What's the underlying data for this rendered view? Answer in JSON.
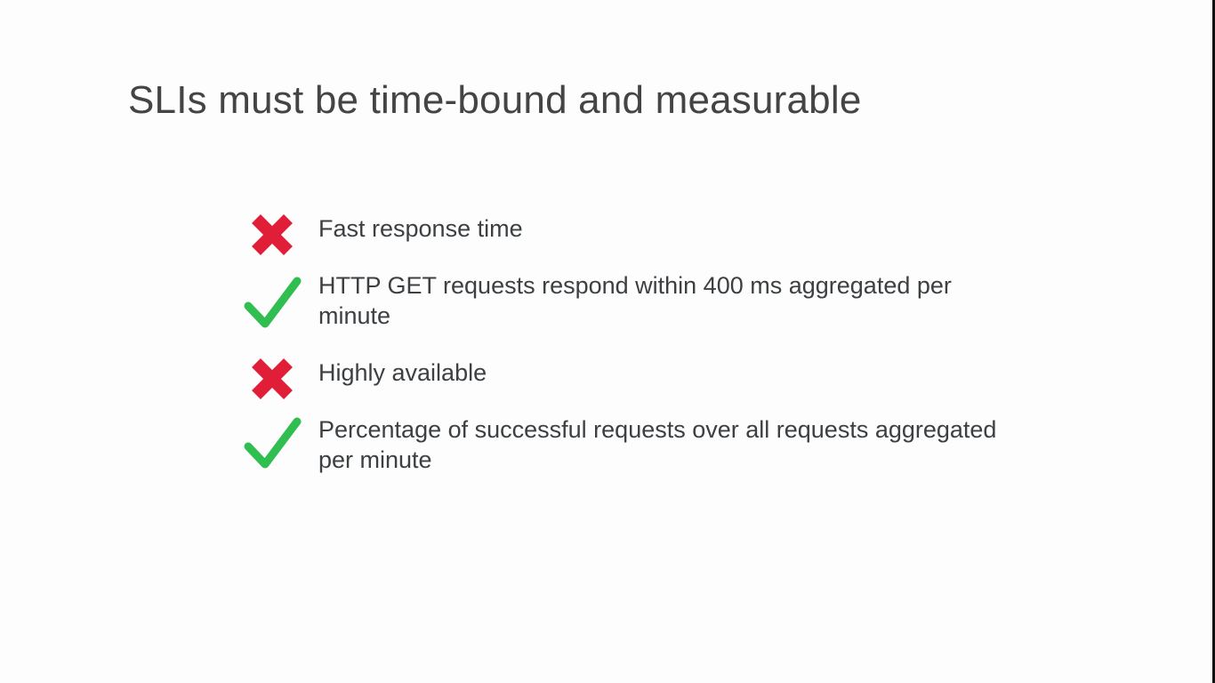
{
  "title": "SLIs must be time-bound and measurable",
  "colors": {
    "cross": "#e01e37",
    "check": "#2fbe4f",
    "text": "#3c4043",
    "title": "#444444"
  },
  "items": [
    {
      "icon": "cross-icon",
      "text": "Fast response time"
    },
    {
      "icon": "check-icon",
      "text": "HTTP GET requests respond within 400 ms aggregated per minute"
    },
    {
      "icon": "cross-icon",
      "text": "Highly available"
    },
    {
      "icon": "check-icon",
      "text": "Percentage of successful requests over all requests aggregated per minute"
    }
  ]
}
